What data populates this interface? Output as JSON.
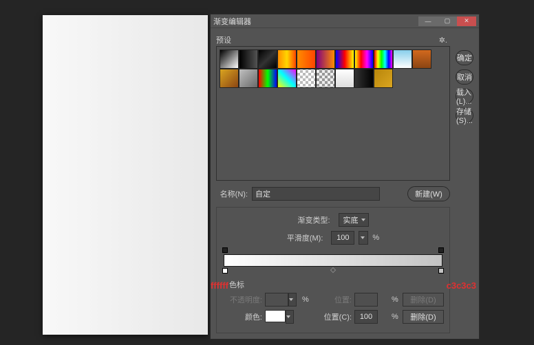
{
  "window": {
    "title": "渐变编辑器"
  },
  "buttons": {
    "ok": "确定",
    "cancel": "取消",
    "load": "载入(L)...",
    "save": "存储(S)...",
    "new": "新建(W)",
    "delete1": "删除(D)",
    "delete2": "删除(D)"
  },
  "labels": {
    "presets": "预设",
    "name": "名称(N):",
    "gtype": "渐变类型:",
    "smooth": "平滑度(M):",
    "stops": "色标",
    "opacity": "不透明度:",
    "position1": "位置:",
    "color": "颜色:",
    "position2": "位置(C):",
    "pct": "%"
  },
  "fields": {
    "name_value": "自定",
    "gtype_value": "实底",
    "smooth_value": "100",
    "opacity_value": "",
    "position1_value": "",
    "position2_value": "100"
  },
  "annotations": {
    "left": "ffffff",
    "right": "c3c3c3"
  },
  "gradient": {
    "start": "#ffffff",
    "end": "#c3c3c3"
  },
  "presets": [
    "linear-gradient(135deg,#000,#fff)",
    "linear-gradient(to right,#000,transparent)",
    "linear-gradient(135deg,#000,#333,#000)",
    "linear-gradient(to right,#ff8c00,#ffd700,#ff4500)",
    "linear-gradient(to right,#ff8c00,#ff4500)",
    "linear-gradient(to right,#800080,#ff8c00)",
    "linear-gradient(to right,#0000ff,#ff0000,#ffff00)",
    "linear-gradient(to right,#ffff00,#ff0000,#ff00ff,#0000ff)",
    "linear-gradient(to right,#ff0000,#ffff00,#00ff00,#00ffff,#0000ff,#ff00ff)",
    "linear-gradient(to bottom,#87ceeb,#fff)",
    "linear-gradient(to bottom,#d2691e,#8b4513)",
    "linear-gradient(135deg,#daa520,#8b4513)",
    "linear-gradient(135deg,#c0c0c0,#696969)",
    "linear-gradient(to right,#ff0000,#00ff00,#0000ff)",
    "linear-gradient(45deg,#ffff00,#00ffff,#ff00ff)",
    "repeating-conic-gradient(#bbb 0 25%,#fff 0 50%) 0/8px 8px",
    "repeating-conic-gradient(#999 0 25%,#eee 0 50%) 0/8px 8px",
    "linear-gradient(to bottom,#fff,#ddd)",
    "linear-gradient(to right,#333,#000)",
    "linear-gradient(135deg,#b8860b,#daa520)"
  ]
}
